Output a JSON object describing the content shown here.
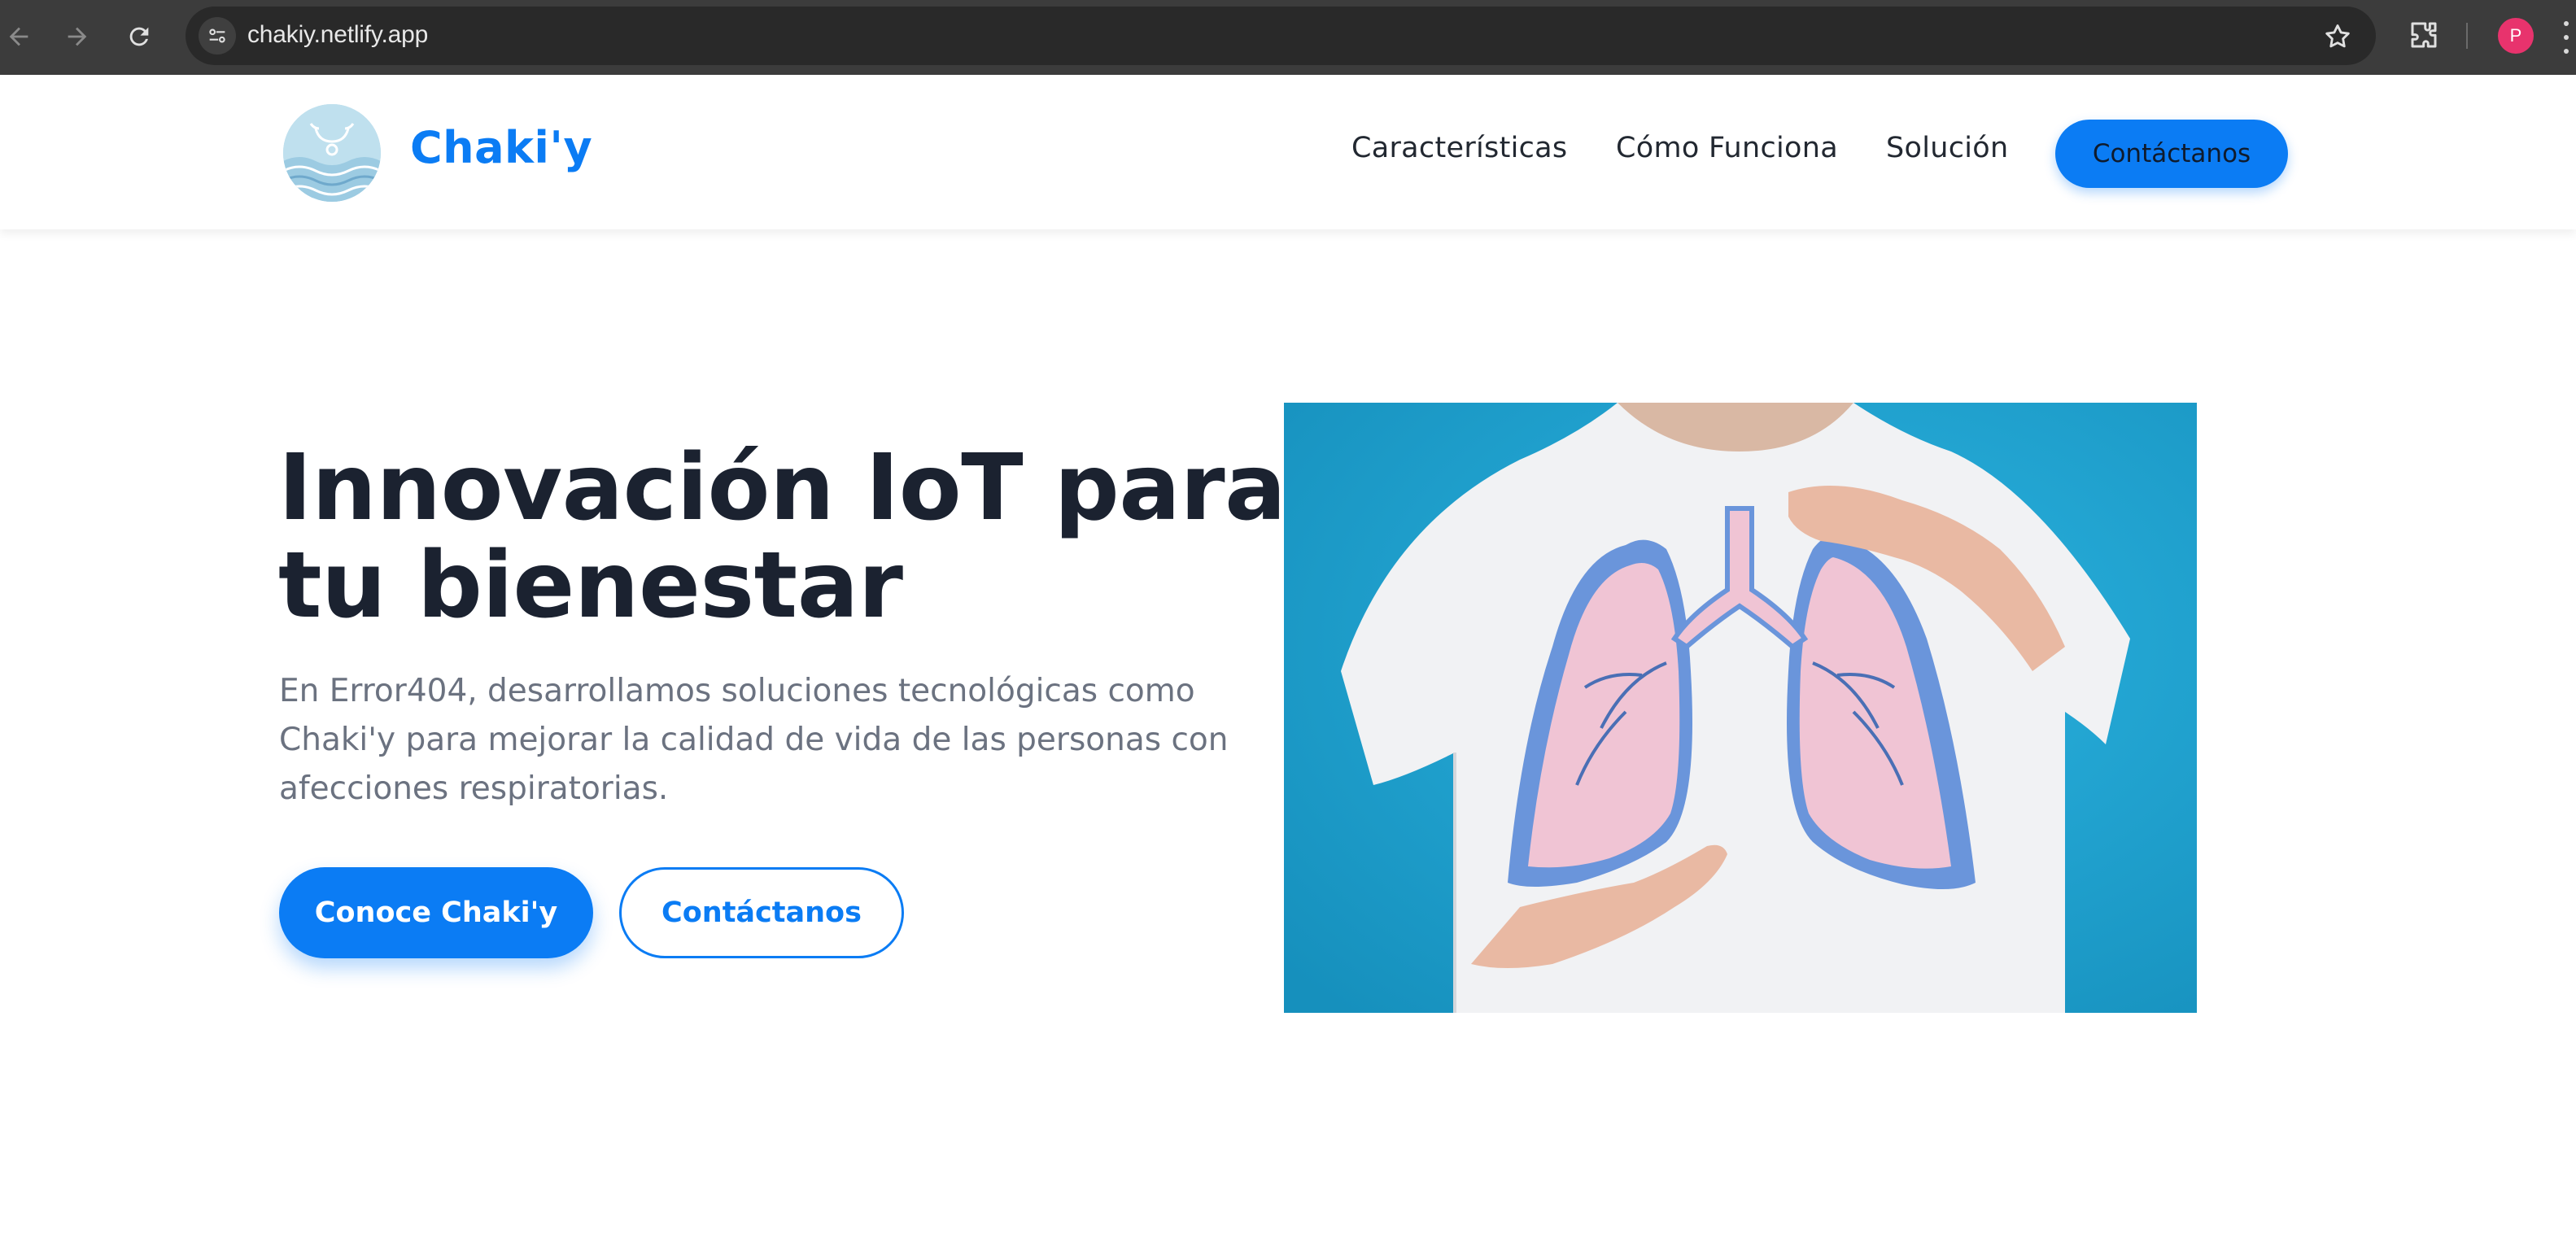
{
  "browser": {
    "url": "chakiy.netlify.app",
    "profile_initial": "P",
    "icons": [
      "back-arrow-icon",
      "forward-arrow-icon",
      "reload-icon",
      "site-info-icon",
      "bookmark-star-icon",
      "extensions-icon",
      "menu-icon"
    ]
  },
  "header": {
    "brand": "Chaki'y",
    "nav": [
      "Características",
      "Cómo Funciona",
      "Solución"
    ],
    "cta": "Contáctanos"
  },
  "hero": {
    "title_line1": "Innovación IoT para",
    "title_line2": "tu bienestar",
    "description": "En Error404, desarrollamos soluciones tecnológicas como Chaki'y para mejorar la calidad de vida de las personas con afecciones respiratorias.",
    "primary_button": "Conoce Chaki'y",
    "secondary_button": "Contáctanos"
  },
  "colors": {
    "accent": "#0b7cf4",
    "heading": "#1b2230",
    "body_text": "#6b7280",
    "chrome_bg": "#3c3c3c"
  }
}
